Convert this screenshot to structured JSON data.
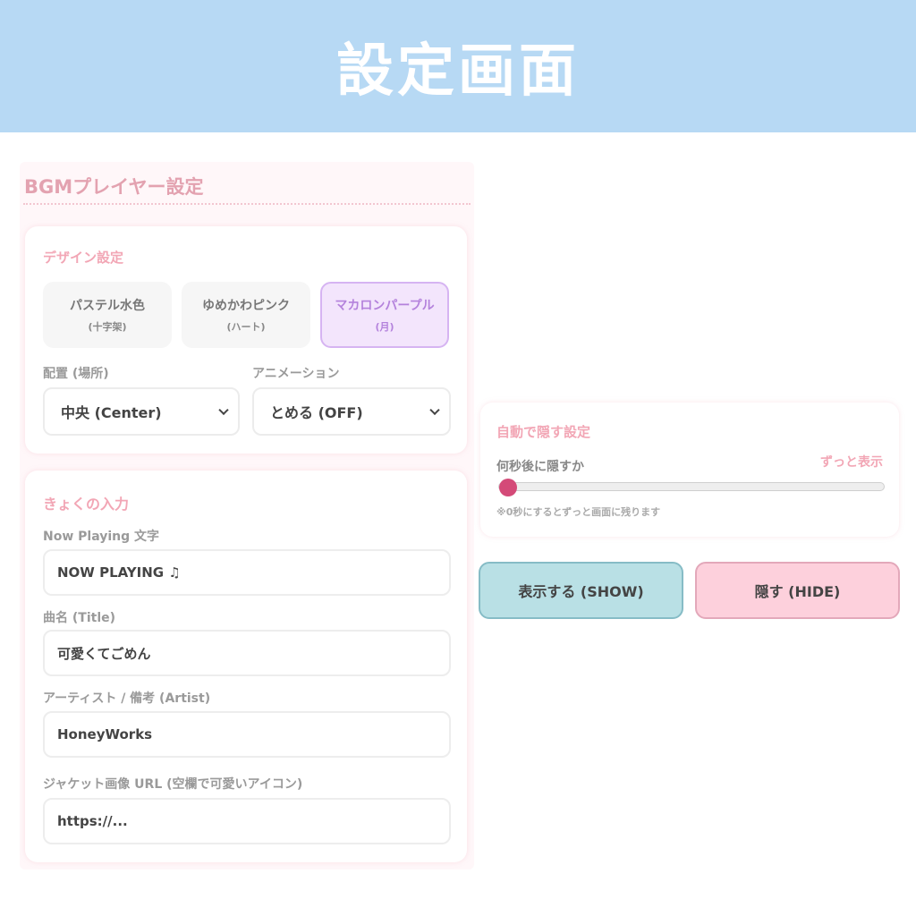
{
  "banner": {
    "title": "設定画面"
  },
  "panel": {
    "title": "BGMプレイヤー設定"
  },
  "design": {
    "heading": "デザイン設定",
    "themes": [
      {
        "name": "パステル水色",
        "sub": "(十字架)"
      },
      {
        "name": "ゆめかわピンク",
        "sub": "(ハート)"
      },
      {
        "name": "マカロンパープル",
        "sub": "(月)"
      }
    ],
    "selected_theme": 2,
    "position": {
      "label": "配置 (場所)",
      "value": "中央 (Center)"
    },
    "animation": {
      "label": "アニメーション",
      "value": "とめる (OFF)"
    }
  },
  "song": {
    "heading": "きょくの入力",
    "fields": [
      {
        "label": "Now Playing 文字",
        "value": "NOW PLAYING ♫"
      },
      {
        "label": "曲名 (Title)",
        "value": "可愛くてごめん"
      },
      {
        "label": "アーティスト / 備考 (Artist)",
        "value": "HoneyWorks"
      },
      {
        "label": "ジャケット画像 URL (空欄で可愛いアイコン)",
        "value": "https://..."
      }
    ]
  },
  "autohide": {
    "heading": "自動で隠す設定",
    "label": "何秒後に隠すか",
    "value_text": "ずっと表示",
    "slider_fraction": 0,
    "note": "※0秒にするとずっと画面に残ります"
  },
  "actions": {
    "show_label": "表示する (SHOW)",
    "hide_label": "隠す (HIDE)"
  },
  "colors": {
    "banner": "#b7d9f4",
    "accent_pink": "#f2a6b5",
    "selected_purple": "#b482dc",
    "slider_thumb": "#d44a78",
    "show_button": "#b9e0e5",
    "hide_button": "#fdd0dc"
  }
}
